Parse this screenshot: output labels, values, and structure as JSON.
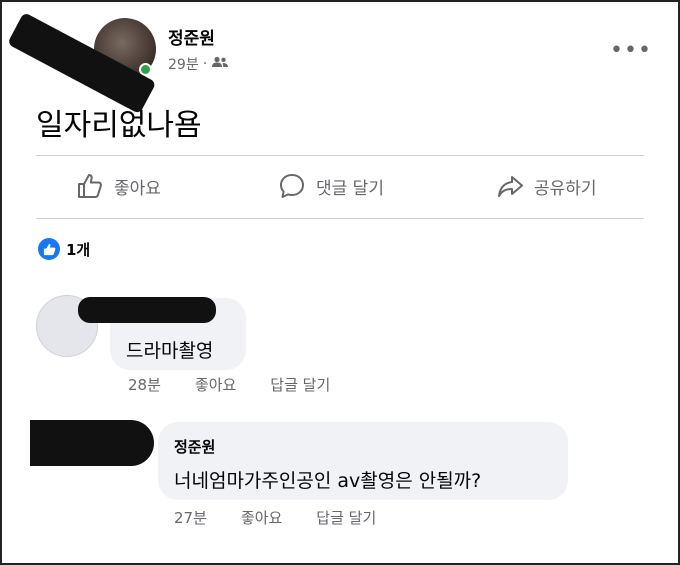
{
  "post": {
    "author": "정준원",
    "time": "29분",
    "separator": "·",
    "text": "일자리없나욤"
  },
  "actions": {
    "like": "좋아요",
    "comment": "댓글 달기",
    "share": "공유하기"
  },
  "reactions": {
    "count": "1개"
  },
  "comments": [
    {
      "text": "드라마촬영",
      "time": "28분",
      "like": "좋아요",
      "reply": "답글 달기"
    },
    {
      "author": "정준원",
      "text": "너네엄마가주인공인 av촬영은 안될까?",
      "time": "27분",
      "like": "좋아요",
      "reply": "답글 달기"
    }
  ],
  "colors": {
    "accent": "#1877f2",
    "online": "#31a24c",
    "meta_text": "#65676b",
    "bubble": "#f0f2f5"
  },
  "icons": [
    "back-arrow-icon",
    "friends-audience-icon",
    "more-options-icon",
    "thumbs-up-icon",
    "comment-icon",
    "share-icon",
    "like-reaction-icon"
  ]
}
